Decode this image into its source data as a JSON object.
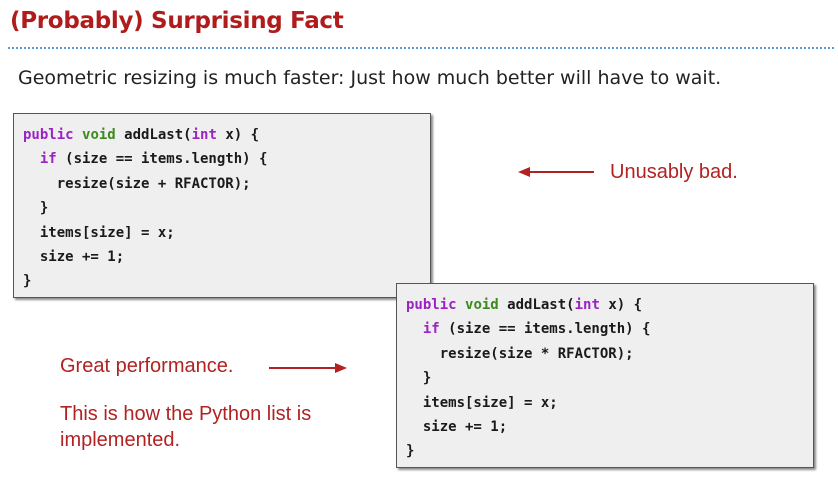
{
  "title": "(Probably) Surprising Fact",
  "subtitle": "Geometric resizing is much faster: Just how much better will have to wait.",
  "code_blocks": [
    {
      "lines": [
        {
          "indent": "",
          "tokens": [
            {
              "text": "public",
              "style": "kw-purple"
            },
            {
              "text": " ",
              "style": ""
            },
            {
              "text": "void",
              "style": "kw-green"
            },
            {
              "text": " addLast(",
              "style": ""
            },
            {
              "text": "int",
              "style": "kw-purple"
            },
            {
              "text": " x) {",
              "style": ""
            }
          ]
        },
        {
          "indent": "  ",
          "tokens": [
            {
              "text": "if",
              "style": "kw-purple"
            },
            {
              "text": " (size == items.length) {",
              "style": ""
            }
          ]
        },
        {
          "indent": "    ",
          "tokens": [
            {
              "text": "resize(size + RFACTOR);",
              "style": ""
            }
          ]
        },
        {
          "indent": "  ",
          "tokens": [
            {
              "text": "}",
              "style": ""
            }
          ]
        },
        {
          "indent": "  ",
          "tokens": [
            {
              "text": "items[size] = x;",
              "style": ""
            }
          ]
        },
        {
          "indent": "  ",
          "tokens": [
            {
              "text": "size += 1;",
              "style": ""
            }
          ]
        },
        {
          "indent": "",
          "tokens": [
            {
              "text": "}",
              "style": ""
            }
          ]
        }
      ]
    },
    {
      "lines": [
        {
          "indent": "",
          "tokens": [
            {
              "text": "public",
              "style": "kw-purple"
            },
            {
              "text": " ",
              "style": ""
            },
            {
              "text": "void",
              "style": "kw-green"
            },
            {
              "text": " addLast(",
              "style": ""
            },
            {
              "text": "int",
              "style": "kw-purple"
            },
            {
              "text": " x) {",
              "style": ""
            }
          ]
        },
        {
          "indent": "  ",
          "tokens": [
            {
              "text": "if",
              "style": "kw-purple"
            },
            {
              "text": " (size == items.length) {",
              "style": ""
            }
          ]
        },
        {
          "indent": "    ",
          "tokens": [
            {
              "text": "resize(size * RFACTOR);",
              "style": ""
            }
          ]
        },
        {
          "indent": "  ",
          "tokens": [
            {
              "text": "}",
              "style": ""
            }
          ]
        },
        {
          "indent": "  ",
          "tokens": [
            {
              "text": "items[size] = x;",
              "style": ""
            }
          ]
        },
        {
          "indent": "  ",
          "tokens": [
            {
              "text": "size += 1;",
              "style": ""
            }
          ]
        },
        {
          "indent": "",
          "tokens": [
            {
              "text": "}",
              "style": ""
            }
          ]
        }
      ]
    }
  ],
  "annotations": {
    "unusably_bad": "Unusably bad.",
    "great_performance": "Great performance.",
    "python_line1": "This is how the Python list is",
    "python_line2": "implemented."
  },
  "colors": {
    "title": "#b01c1c",
    "annotation": "#b22222",
    "keyword_purple": "#9b22c3",
    "keyword_green": "#3d8a1d",
    "rule": "#5b9bd5"
  }
}
